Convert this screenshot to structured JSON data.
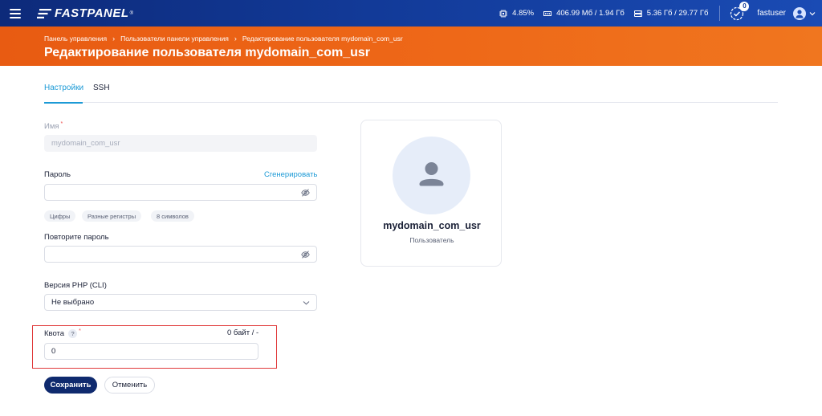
{
  "topbar": {
    "logo_text": "FASTPANEL",
    "logo_reg": "®",
    "cpu": "4.85%",
    "memory": "406.99 Мб / 1.94 Гб",
    "disk": "5.36 Гб / 29.77 Гб",
    "notifications_count": "0",
    "username": "fastuser"
  },
  "breadcrumb": {
    "items": [
      "Панель управления",
      "Пользователи панели управления",
      "Редактирование пользователя mydomain_com_usr"
    ],
    "separator": "›"
  },
  "page_title": "Редактирование пользователя mydomain_com_usr",
  "tabs": [
    {
      "label": "Настройки",
      "active": true
    },
    {
      "label": "SSH",
      "active": false
    }
  ],
  "form": {
    "name_label": "Имя",
    "name_value": "mydomain_com_usr",
    "password_label": "Пароль",
    "generate_label": "Сгенерировать",
    "password_value": "",
    "password_hints": [
      "Цифры",
      "Разные регистры",
      "8 символов"
    ],
    "repeat_password_label": "Повторите пароль",
    "repeat_password_value": "",
    "php_label": "Версия PHP (CLI)",
    "php_value": "Не выбрано",
    "quota_label": "Квота",
    "quota_help": "?",
    "quota_usage": "0 байт / -",
    "quota_value": "0",
    "required_mark": "*",
    "save_label": "Сохранить",
    "cancel_label": "Отменить"
  },
  "user_card": {
    "name": "mydomain_com_usr",
    "role": "Пользователь"
  },
  "colors": {
    "topbar": "#123a98",
    "header": "#ee6818",
    "accent": "#1c9ad6",
    "primary_button": "#0f2a6e",
    "highlight_box": "#e0393a"
  }
}
